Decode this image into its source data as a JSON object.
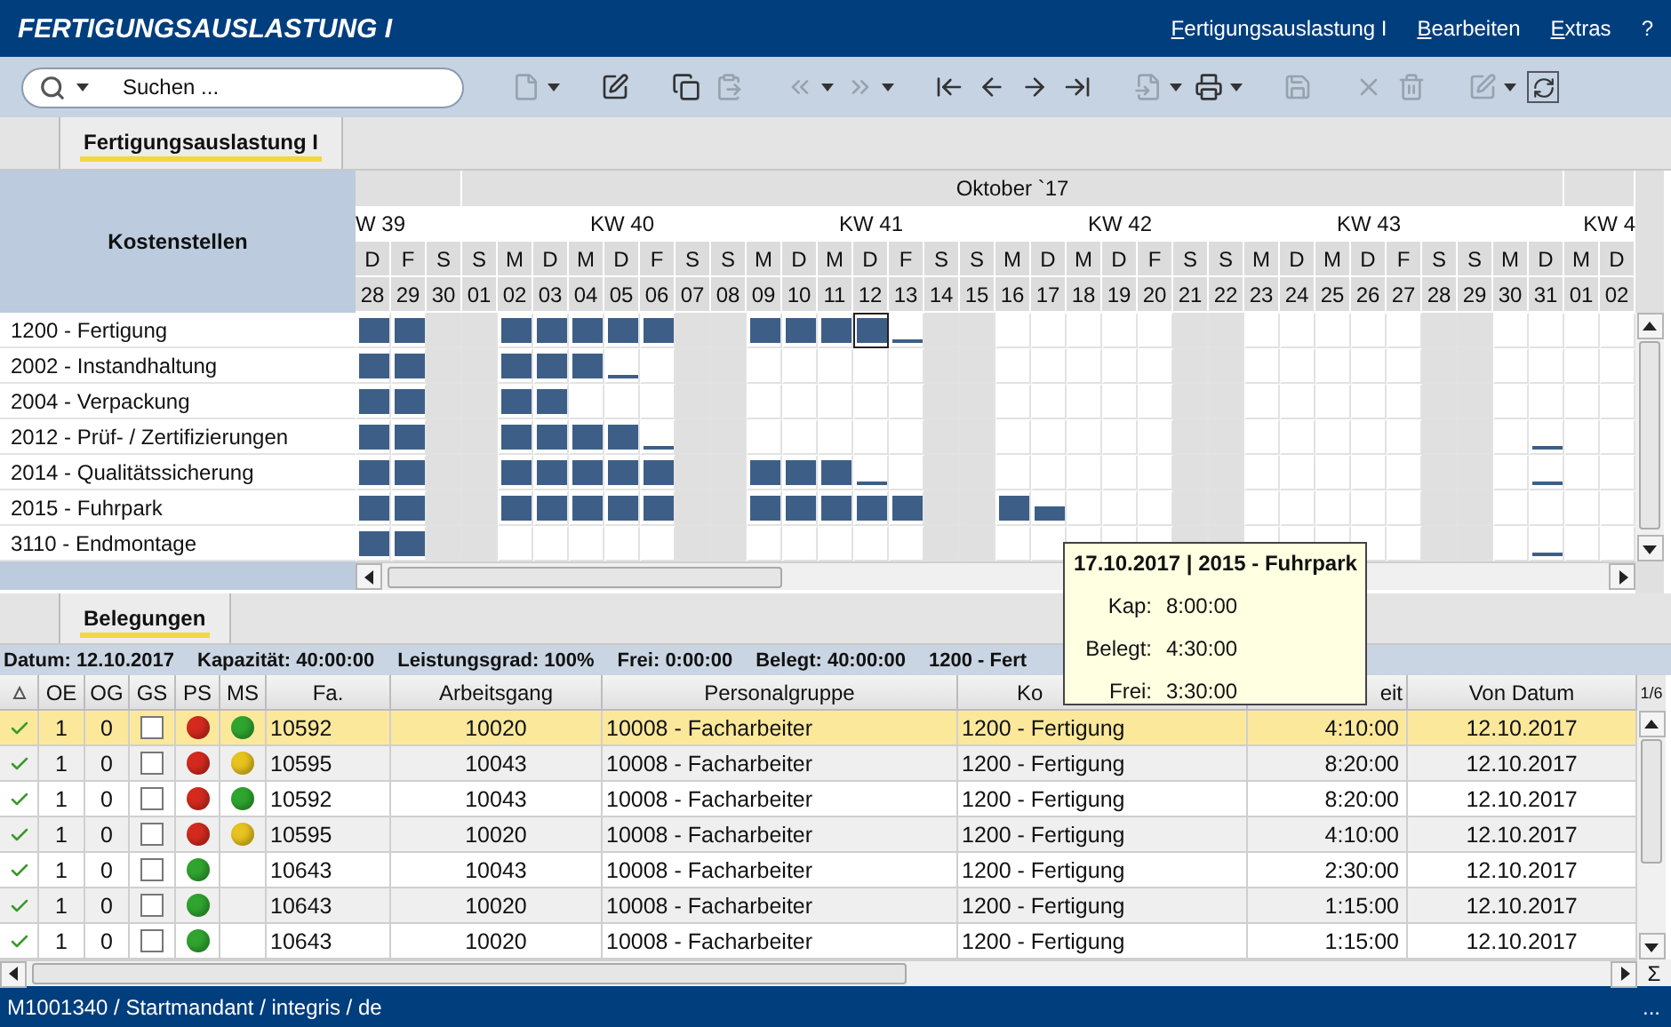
{
  "title": "FERTIGUNGSAUSLASTUNG I",
  "menu": [
    {
      "label": "Fertigungsauslastung I",
      "mnemonic": true
    },
    {
      "label": "Bearbeiten",
      "mnemonic": true
    },
    {
      "label": "Extras",
      "mnemonic": true
    },
    {
      "label": "?",
      "mnemonic": false
    }
  ],
  "search": {
    "placeholder": "Suchen ..."
  },
  "toolbar": {
    "groups": [
      [
        {
          "disabled": true,
          "dropdown": true
        }
      ],
      [
        {
          "disabled": false,
          "dropdown": false
        }
      ],
      [
        {
          "disabled": false,
          "dropdown": false
        },
        {
          "disabled": true,
          "dropdown": false
        }
      ],
      [
        {
          "disabled": true,
          "dropdown": true
        },
        {
          "disabled": true,
          "dropdown": true
        }
      ],
      [
        {
          "disabled": false,
          "dropdown": false
        },
        {
          "disabled": false,
          "dropdown": false
        },
        {
          "disabled": false,
          "dropdown": false
        },
        {
          "disabled": false,
          "dropdown": false
        }
      ],
      [
        {
          "disabled": true,
          "dropdown": true
        },
        {
          "disabled": false,
          "dropdown": true
        }
      ],
      [
        {
          "disabled": true,
          "dropdown": false
        }
      ],
      [
        {
          "disabled": true,
          "dropdown": false
        },
        {
          "disabled": true,
          "dropdown": false
        }
      ],
      [
        {
          "disabled": true,
          "dropdown": true
        },
        {
          "disabled": false,
          "dropdown": false
        }
      ]
    ]
  },
  "top_tabs": [
    {
      "label": "Fertigungsauslastung I",
      "selected": true
    }
  ],
  "gantt": {
    "header_label": "Kostenstellen",
    "month": "Oktober `17",
    "weeks": [
      {
        "label": "W 39",
        "days": [
          {
            "weekday": "D",
            "date": "28",
            "weekend": false
          },
          {
            "weekday": "F",
            "date": "29",
            "weekend": false
          },
          {
            "weekday": "S",
            "date": "30",
            "weekend": true
          },
          {
            "weekday": "S",
            "date": "01",
            "weekend": true
          }
        ]
      },
      {
        "label": "KW 40",
        "days": [
          {
            "weekday": "M",
            "date": "02",
            "weekend": false
          },
          {
            "weekday": "D",
            "date": "03",
            "weekend": false
          },
          {
            "weekday": "M",
            "date": "04",
            "weekend": false
          },
          {
            "weekday": "D",
            "date": "05",
            "weekend": false
          },
          {
            "weekday": "F",
            "date": "06",
            "weekend": false
          },
          {
            "weekday": "S",
            "date": "07",
            "weekend": true
          },
          {
            "weekday": "S",
            "date": "08",
            "weekend": true
          }
        ]
      },
      {
        "label": "KW 41",
        "days": [
          {
            "weekday": "M",
            "date": "09",
            "weekend": false
          },
          {
            "weekday": "D",
            "date": "10",
            "weekend": false
          },
          {
            "weekday": "M",
            "date": "11",
            "weekend": false
          },
          {
            "weekday": "D",
            "date": "12",
            "weekend": false
          },
          {
            "weekday": "F",
            "date": "13",
            "weekend": false
          },
          {
            "weekday": "S",
            "date": "14",
            "weekend": true
          },
          {
            "weekday": "S",
            "date": "15",
            "weekend": true
          }
        ]
      },
      {
        "label": "KW 42",
        "days": [
          {
            "weekday": "M",
            "date": "16",
            "weekend": false
          },
          {
            "weekday": "D",
            "date": "17",
            "weekend": false
          },
          {
            "weekday": "M",
            "date": "18",
            "weekend": false
          },
          {
            "weekday": "D",
            "date": "19",
            "weekend": false
          },
          {
            "weekday": "F",
            "date": "20",
            "weekend": false
          },
          {
            "weekday": "S",
            "date": "21",
            "weekend": true
          },
          {
            "weekday": "S",
            "date": "22",
            "weekend": true
          }
        ]
      },
      {
        "label": "KW 43",
        "days": [
          {
            "weekday": "M",
            "date": "23",
            "weekend": false
          },
          {
            "weekday": "D",
            "date": "24",
            "weekend": false
          },
          {
            "weekday": "M",
            "date": "25",
            "weekend": false
          },
          {
            "weekday": "D",
            "date": "26",
            "weekend": false
          },
          {
            "weekday": "F",
            "date": "27",
            "weekend": false
          },
          {
            "weekday": "S",
            "date": "28",
            "weekend": true
          },
          {
            "weekday": "S",
            "date": "29",
            "weekend": true
          }
        ]
      },
      {
        "label": "KW 4",
        "days": [
          {
            "weekday": "M",
            "date": "30",
            "weekend": false
          },
          {
            "weekday": "D",
            "date": "31",
            "weekend": false
          },
          {
            "weekday": "M",
            "date": "01",
            "weekend": false
          },
          {
            "weekday": "D",
            "date": "02",
            "weekend": false
          }
        ]
      }
    ],
    "rows": [
      {
        "label": "1200 - Fertigung",
        "cells": [
          {
            "kind": "full",
            "selected": false
          },
          {
            "kind": "full",
            "selected": false
          },
          {
            "kind": "none",
            "selected": false
          },
          {
            "kind": "none",
            "selected": false
          },
          {
            "kind": "full",
            "selected": false
          },
          {
            "kind": "full",
            "selected": false
          },
          {
            "kind": "full",
            "selected": false
          },
          {
            "kind": "full",
            "selected": false
          },
          {
            "kind": "full",
            "selected": false
          },
          {
            "kind": "none",
            "selected": false
          },
          {
            "kind": "none",
            "selected": false
          },
          {
            "kind": "full",
            "selected": false
          },
          {
            "kind": "full",
            "selected": false
          },
          {
            "kind": "full",
            "selected": false
          },
          {
            "kind": "full",
            "selected": true
          },
          {
            "kind": "low",
            "selected": false
          },
          {
            "kind": "none",
            "selected": false
          },
          {
            "kind": "none",
            "selected": false
          },
          {
            "kind": "none",
            "selected": false
          },
          {
            "kind": "none",
            "selected": false
          },
          {
            "kind": "none",
            "selected": false
          },
          {
            "kind": "none",
            "selected": false
          },
          {
            "kind": "none",
            "selected": false
          },
          {
            "kind": "none",
            "selected": false
          },
          {
            "kind": "none",
            "selected": false
          },
          {
            "kind": "none",
            "selected": false
          },
          {
            "kind": "none",
            "selected": false
          },
          {
            "kind": "none",
            "selected": false
          },
          {
            "kind": "none",
            "selected": false
          },
          {
            "kind": "none",
            "selected": false
          },
          {
            "kind": "none",
            "selected": false
          },
          {
            "kind": "none",
            "selected": false
          },
          {
            "kind": "none",
            "selected": false
          },
          {
            "kind": "none",
            "selected": false
          },
          {
            "kind": "none",
            "selected": false
          },
          {
            "kind": "none",
            "selected": false
          }
        ]
      },
      {
        "label": "2002 - Instandhaltung",
        "cells": [
          {
            "kind": "full",
            "selected": false
          },
          {
            "kind": "full",
            "selected": false
          },
          {
            "kind": "none",
            "selected": false
          },
          {
            "kind": "none",
            "selected": false
          },
          {
            "kind": "full",
            "selected": false
          },
          {
            "kind": "full",
            "selected": false
          },
          {
            "kind": "full",
            "selected": false
          },
          {
            "kind": "low",
            "selected": false
          },
          {
            "kind": "none",
            "selected": false
          },
          {
            "kind": "none",
            "selected": false
          },
          {
            "kind": "none",
            "selected": false
          },
          {
            "kind": "none",
            "selected": false
          },
          {
            "kind": "none",
            "selected": false
          },
          {
            "kind": "none",
            "selected": false
          },
          {
            "kind": "none",
            "selected": false
          },
          {
            "kind": "none",
            "selected": false
          },
          {
            "kind": "none",
            "selected": false
          },
          {
            "kind": "none",
            "selected": false
          },
          {
            "kind": "none",
            "selected": false
          },
          {
            "kind": "none",
            "selected": false
          },
          {
            "kind": "none",
            "selected": false
          },
          {
            "kind": "none",
            "selected": false
          },
          {
            "kind": "none",
            "selected": false
          },
          {
            "kind": "none",
            "selected": false
          },
          {
            "kind": "none",
            "selected": false
          },
          {
            "kind": "none",
            "selected": false
          },
          {
            "kind": "none",
            "selected": false
          },
          {
            "kind": "none",
            "selected": false
          },
          {
            "kind": "none",
            "selected": false
          },
          {
            "kind": "none",
            "selected": false
          },
          {
            "kind": "none",
            "selected": false
          },
          {
            "kind": "none",
            "selected": false
          },
          {
            "kind": "none",
            "selected": false
          },
          {
            "kind": "none",
            "selected": false
          },
          {
            "kind": "none",
            "selected": false
          },
          {
            "kind": "none",
            "selected": false
          }
        ]
      },
      {
        "label": "2004 - Verpackung",
        "cells": [
          {
            "kind": "full",
            "selected": false
          },
          {
            "kind": "full",
            "selected": false
          },
          {
            "kind": "none",
            "selected": false
          },
          {
            "kind": "none",
            "selected": false
          },
          {
            "kind": "full",
            "selected": false
          },
          {
            "kind": "full",
            "selected": false
          },
          {
            "kind": "none",
            "selected": false
          },
          {
            "kind": "none",
            "selected": false
          },
          {
            "kind": "none",
            "selected": false
          },
          {
            "kind": "none",
            "selected": false
          },
          {
            "kind": "none",
            "selected": false
          },
          {
            "kind": "none",
            "selected": false
          },
          {
            "kind": "none",
            "selected": false
          },
          {
            "kind": "none",
            "selected": false
          },
          {
            "kind": "none",
            "selected": false
          },
          {
            "kind": "none",
            "selected": false
          },
          {
            "kind": "none",
            "selected": false
          },
          {
            "kind": "none",
            "selected": false
          },
          {
            "kind": "none",
            "selected": false
          },
          {
            "kind": "none",
            "selected": false
          },
          {
            "kind": "none",
            "selected": false
          },
          {
            "kind": "none",
            "selected": false
          },
          {
            "kind": "none",
            "selected": false
          },
          {
            "kind": "none",
            "selected": false
          },
          {
            "kind": "none",
            "selected": false
          },
          {
            "kind": "none",
            "selected": false
          },
          {
            "kind": "none",
            "selected": false
          },
          {
            "kind": "none",
            "selected": false
          },
          {
            "kind": "none",
            "selected": false
          },
          {
            "kind": "none",
            "selected": false
          },
          {
            "kind": "none",
            "selected": false
          },
          {
            "kind": "none",
            "selected": false
          },
          {
            "kind": "none",
            "selected": false
          },
          {
            "kind": "none",
            "selected": false
          },
          {
            "kind": "none",
            "selected": false
          },
          {
            "kind": "none",
            "selected": false
          }
        ]
      },
      {
        "label": "2012 - Prüf- / Zertifizierungen",
        "cells": [
          {
            "kind": "full",
            "selected": false
          },
          {
            "kind": "full",
            "selected": false
          },
          {
            "kind": "none",
            "selected": false
          },
          {
            "kind": "none",
            "selected": false
          },
          {
            "kind": "full",
            "selected": false
          },
          {
            "kind": "full",
            "selected": false
          },
          {
            "kind": "full",
            "selected": false
          },
          {
            "kind": "full",
            "selected": false
          },
          {
            "kind": "low",
            "selected": false
          },
          {
            "kind": "none",
            "selected": false
          },
          {
            "kind": "none",
            "selected": false
          },
          {
            "kind": "none",
            "selected": false
          },
          {
            "kind": "none",
            "selected": false
          },
          {
            "kind": "none",
            "selected": false
          },
          {
            "kind": "none",
            "selected": false
          },
          {
            "kind": "none",
            "selected": false
          },
          {
            "kind": "none",
            "selected": false
          },
          {
            "kind": "none",
            "selected": false
          },
          {
            "kind": "none",
            "selected": false
          },
          {
            "kind": "none",
            "selected": false
          },
          {
            "kind": "none",
            "selected": false
          },
          {
            "kind": "none",
            "selected": false
          },
          {
            "kind": "none",
            "selected": false
          },
          {
            "kind": "none",
            "selected": false
          },
          {
            "kind": "none",
            "selected": false
          },
          {
            "kind": "none",
            "selected": false
          },
          {
            "kind": "none",
            "selected": false
          },
          {
            "kind": "none",
            "selected": false
          },
          {
            "kind": "none",
            "selected": false
          },
          {
            "kind": "none",
            "selected": false
          },
          {
            "kind": "none",
            "selected": false
          },
          {
            "kind": "none",
            "selected": false
          },
          {
            "kind": "none",
            "selected": false
          },
          {
            "kind": "low",
            "selected": false
          },
          {
            "kind": "none",
            "selected": false
          },
          {
            "kind": "none",
            "selected": false
          }
        ]
      },
      {
        "label": "2014 - Qualitätssicherung",
        "cells": [
          {
            "kind": "full",
            "selected": false
          },
          {
            "kind": "full",
            "selected": false
          },
          {
            "kind": "none",
            "selected": false
          },
          {
            "kind": "none",
            "selected": false
          },
          {
            "kind": "full",
            "selected": false
          },
          {
            "kind": "full",
            "selected": false
          },
          {
            "kind": "full",
            "selected": false
          },
          {
            "kind": "full",
            "selected": false
          },
          {
            "kind": "full",
            "selected": false
          },
          {
            "kind": "none",
            "selected": false
          },
          {
            "kind": "none",
            "selected": false
          },
          {
            "kind": "full",
            "selected": false
          },
          {
            "kind": "full",
            "selected": false
          },
          {
            "kind": "full",
            "selected": false
          },
          {
            "kind": "low",
            "selected": false
          },
          {
            "kind": "none",
            "selected": false
          },
          {
            "kind": "none",
            "selected": false
          },
          {
            "kind": "none",
            "selected": false
          },
          {
            "kind": "none",
            "selected": false
          },
          {
            "kind": "none",
            "selected": false
          },
          {
            "kind": "none",
            "selected": false
          },
          {
            "kind": "none",
            "selected": false
          },
          {
            "kind": "none",
            "selected": false
          },
          {
            "kind": "none",
            "selected": false
          },
          {
            "kind": "none",
            "selected": false
          },
          {
            "kind": "none",
            "selected": false
          },
          {
            "kind": "none",
            "selected": false
          },
          {
            "kind": "none",
            "selected": false
          },
          {
            "kind": "none",
            "selected": false
          },
          {
            "kind": "none",
            "selected": false
          },
          {
            "kind": "none",
            "selected": false
          },
          {
            "kind": "none",
            "selected": false
          },
          {
            "kind": "none",
            "selected": false
          },
          {
            "kind": "low",
            "selected": false
          },
          {
            "kind": "none",
            "selected": false
          },
          {
            "kind": "none",
            "selected": false
          }
        ]
      },
      {
        "label": "2015 - Fuhrpark",
        "cells": [
          {
            "kind": "full",
            "selected": false
          },
          {
            "kind": "full",
            "selected": false
          },
          {
            "kind": "none",
            "selected": false
          },
          {
            "kind": "none",
            "selected": false
          },
          {
            "kind": "full",
            "selected": false
          },
          {
            "kind": "full",
            "selected": false
          },
          {
            "kind": "full",
            "selected": false
          },
          {
            "kind": "full",
            "selected": false
          },
          {
            "kind": "full",
            "selected": false
          },
          {
            "kind": "none",
            "selected": false
          },
          {
            "kind": "none",
            "selected": false
          },
          {
            "kind": "full",
            "selected": false
          },
          {
            "kind": "full",
            "selected": false
          },
          {
            "kind": "full",
            "selected": false
          },
          {
            "kind": "full",
            "selected": false
          },
          {
            "kind": "full",
            "selected": false
          },
          {
            "kind": "none",
            "selected": false
          },
          {
            "kind": "none",
            "selected": false
          },
          {
            "kind": "full",
            "selected": false
          },
          {
            "kind": "half",
            "selected": false
          },
          {
            "kind": "none",
            "selected": false
          },
          {
            "kind": "none",
            "selected": false
          },
          {
            "kind": "none",
            "selected": false
          },
          {
            "kind": "none",
            "selected": false
          },
          {
            "kind": "none",
            "selected": false
          },
          {
            "kind": "none",
            "selected": false
          },
          {
            "kind": "none",
            "selected": false
          },
          {
            "kind": "none",
            "selected": false
          },
          {
            "kind": "none",
            "selected": false
          },
          {
            "kind": "none",
            "selected": false
          },
          {
            "kind": "none",
            "selected": false
          },
          {
            "kind": "none",
            "selected": false
          },
          {
            "kind": "none",
            "selected": false
          },
          {
            "kind": "none",
            "selected": false
          },
          {
            "kind": "none",
            "selected": false
          },
          {
            "kind": "none",
            "selected": false
          }
        ]
      },
      {
        "label": "3110 - Endmontage",
        "cells": [
          {
            "kind": "full",
            "selected": false
          },
          {
            "kind": "full",
            "selected": false
          },
          {
            "kind": "none",
            "selected": false
          },
          {
            "kind": "none",
            "selected": false
          },
          {
            "kind": "none",
            "selected": false
          },
          {
            "kind": "none",
            "selected": false
          },
          {
            "kind": "none",
            "selected": false
          },
          {
            "kind": "none",
            "selected": false
          },
          {
            "kind": "none",
            "selected": false
          },
          {
            "kind": "none",
            "selected": false
          },
          {
            "kind": "none",
            "selected": false
          },
          {
            "kind": "none",
            "selected": false
          },
          {
            "kind": "none",
            "selected": false
          },
          {
            "kind": "none",
            "selected": false
          },
          {
            "kind": "none",
            "selected": false
          },
          {
            "kind": "none",
            "selected": false
          },
          {
            "kind": "none",
            "selected": false
          },
          {
            "kind": "none",
            "selected": false
          },
          {
            "kind": "none",
            "selected": false
          },
          {
            "kind": "none",
            "selected": false
          },
          {
            "kind": "none",
            "selected": false
          },
          {
            "kind": "none",
            "selected": false
          },
          {
            "kind": "none",
            "selected": false
          },
          {
            "kind": "none",
            "selected": false
          },
          {
            "kind": "none",
            "selected": false
          },
          {
            "kind": "none",
            "selected": false
          },
          {
            "kind": "none",
            "selected": false
          },
          {
            "kind": "none",
            "selected": false
          },
          {
            "kind": "none",
            "selected": false
          },
          {
            "kind": "none",
            "selected": false
          },
          {
            "kind": "none",
            "selected": false
          },
          {
            "kind": "none",
            "selected": false
          },
          {
            "kind": "none",
            "selected": false
          },
          {
            "kind": "low",
            "selected": false
          },
          {
            "kind": "none",
            "selected": false
          },
          {
            "kind": "none",
            "selected": false
          }
        ]
      }
    ]
  },
  "tooltip": {
    "title": "17.10.2017 | 2015 - Fuhrpark",
    "lines": [
      {
        "label": "Kap:",
        "value": "8:00:00"
      },
      {
        "label": "Belegt:",
        "value": "4:30:00"
      },
      {
        "label": "Frei:",
        "value": "3:30:00"
      }
    ]
  },
  "bottom_tabs": [
    {
      "label": "Belegungen",
      "selected": true
    }
  ],
  "info": [
    "Datum: 12.10.2017",
    "Kapazität: 40:00:00",
    "Leistungsgrad: 100%",
    "Frei: 0:00:00",
    "Belegt: 40:00:00",
    "1200 - Fert"
  ],
  "table": {
    "page": "1/6",
    "sum_label": "Σ",
    "columns": [
      "OE",
      "OG",
      "GS",
      "PS",
      "MS",
      "Fa.",
      "Arbeitsgang",
      "Personalgruppe",
      "Ko",
      "eit",
      "Von Datum"
    ],
    "rows": [
      {
        "selected": true,
        "done": true,
        "oe": "1",
        "og": "0",
        "gs": {
          "checked": false
        },
        "ps": {
          "color": "#d42a1e"
        },
        "ms": {
          "color": "#2fa52f"
        },
        "fa": "10592",
        "arbeitsgang": "10020",
        "personalgruppe": "10008 - Facharbeiter",
        "kostenstelle": "1200 - Fertigung",
        "zeit": "4:10:00",
        "von_datum": "12.10.2017"
      },
      {
        "selected": false,
        "done": true,
        "oe": "1",
        "og": "0",
        "gs": {
          "checked": false
        },
        "ps": {
          "color": "#d42a1e"
        },
        "ms": {
          "color": "#e8c21e"
        },
        "fa": "10595",
        "arbeitsgang": "10043",
        "personalgruppe": "10008 - Facharbeiter",
        "kostenstelle": "1200 - Fertigung",
        "zeit": "8:20:00",
        "von_datum": "12.10.2017"
      },
      {
        "selected": false,
        "done": true,
        "oe": "1",
        "og": "0",
        "gs": {
          "checked": false
        },
        "ps": {
          "color": "#d42a1e"
        },
        "ms": {
          "color": "#2fa52f"
        },
        "fa": "10592",
        "arbeitsgang": "10043",
        "personalgruppe": "10008 - Facharbeiter",
        "kostenstelle": "1200 - Fertigung",
        "zeit": "8:20:00",
        "von_datum": "12.10.2017"
      },
      {
        "selected": false,
        "done": true,
        "oe": "1",
        "og": "0",
        "gs": {
          "checked": false
        },
        "ps": {
          "color": "#d42a1e"
        },
        "ms": {
          "color": "#e8c21e"
        },
        "fa": "10595",
        "arbeitsgang": "10020",
        "personalgruppe": "10008 - Facharbeiter",
        "kostenstelle": "1200 - Fertigung",
        "zeit": "4:10:00",
        "von_datum": "12.10.2017"
      },
      {
        "selected": false,
        "done": true,
        "oe": "1",
        "og": "0",
        "gs": {
          "checked": false
        },
        "ps": {
          "color": "#2fa52f"
        },
        "fa": "10643",
        "arbeitsgang": "10043",
        "personalgruppe": "10008 - Facharbeiter",
        "kostenstelle": "1200 - Fertigung",
        "zeit": "2:30:00",
        "von_datum": "12.10.2017"
      },
      {
        "selected": false,
        "done": true,
        "oe": "1",
        "og": "0",
        "gs": {
          "checked": false
        },
        "ps": {
          "color": "#2fa52f"
        },
        "fa": "10643",
        "arbeitsgang": "10020",
        "personalgruppe": "10008 - Facharbeiter",
        "kostenstelle": "1200 - Fertigung",
        "zeit": "1:15:00",
        "von_datum": "12.10.2017"
      },
      {
        "selected": false,
        "done": true,
        "oe": "1",
        "og": "0",
        "gs": {
          "checked": false
        },
        "ps": {
          "color": "#2fa52f"
        },
        "fa": "10643",
        "arbeitsgang": "10020",
        "personalgruppe": "10008 - Facharbeiter",
        "kostenstelle": "1200 - Fertigung",
        "zeit": "1:15:00",
        "von_datum": "12.10.2017"
      }
    ]
  },
  "status_bar": {
    "text": "M1001340 / Startmandant / integris / de",
    "more": "..."
  }
}
